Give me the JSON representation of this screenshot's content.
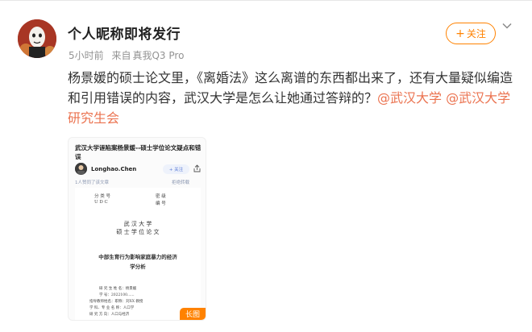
{
  "post": {
    "username": "个人昵称即将发行",
    "time": "5小时前",
    "source_prefix": "来自",
    "source": "真我Q3 Pro",
    "follow_label": "关注",
    "text_main": "杨景媛的硕士论文里，《离婚法》这么离谱的东西都出来了，还有大量疑似编造和引用错误的内容，武汉大学是怎么让她通过答辩的？",
    "mention_1": "@武汉大学",
    "mention_2": "@武汉大学研究生会"
  },
  "image": {
    "title": "武汉大学诬陷案杨景媛--硕士学位论文疑点和错误",
    "author": "Longhao.Chen",
    "follow_label": "+ 关注",
    "agree": "1人赞同了该文章",
    "reject": "拒绝转载",
    "doc_fields": [
      "分 类 号",
      "密 级",
      "U D C",
      "编 号"
    ],
    "doc_university": "武 汉 大 学",
    "doc_degree": "硕 士 学 位 论 文",
    "doc_thesis_title_1": "中部生育行为影响家庭暴力的经济",
    "doc_thesis_title_2": "学分析",
    "doc_info": [
      "研 究 生 姓 名：杨景媛",
      "学 号：2022100......",
      "指导教师姓名：职称：刘XX 教授",
      "学 科、专 业 名 称：人口学",
      "研 究 方 向：人口与经济"
    ],
    "badge": "长图"
  },
  "colors": {
    "accent": "#ff8200",
    "mention": "#eb7350",
    "meta": "#939393"
  },
  "icons": {
    "chevron": "chevron-down-icon",
    "share": "share-icon"
  }
}
